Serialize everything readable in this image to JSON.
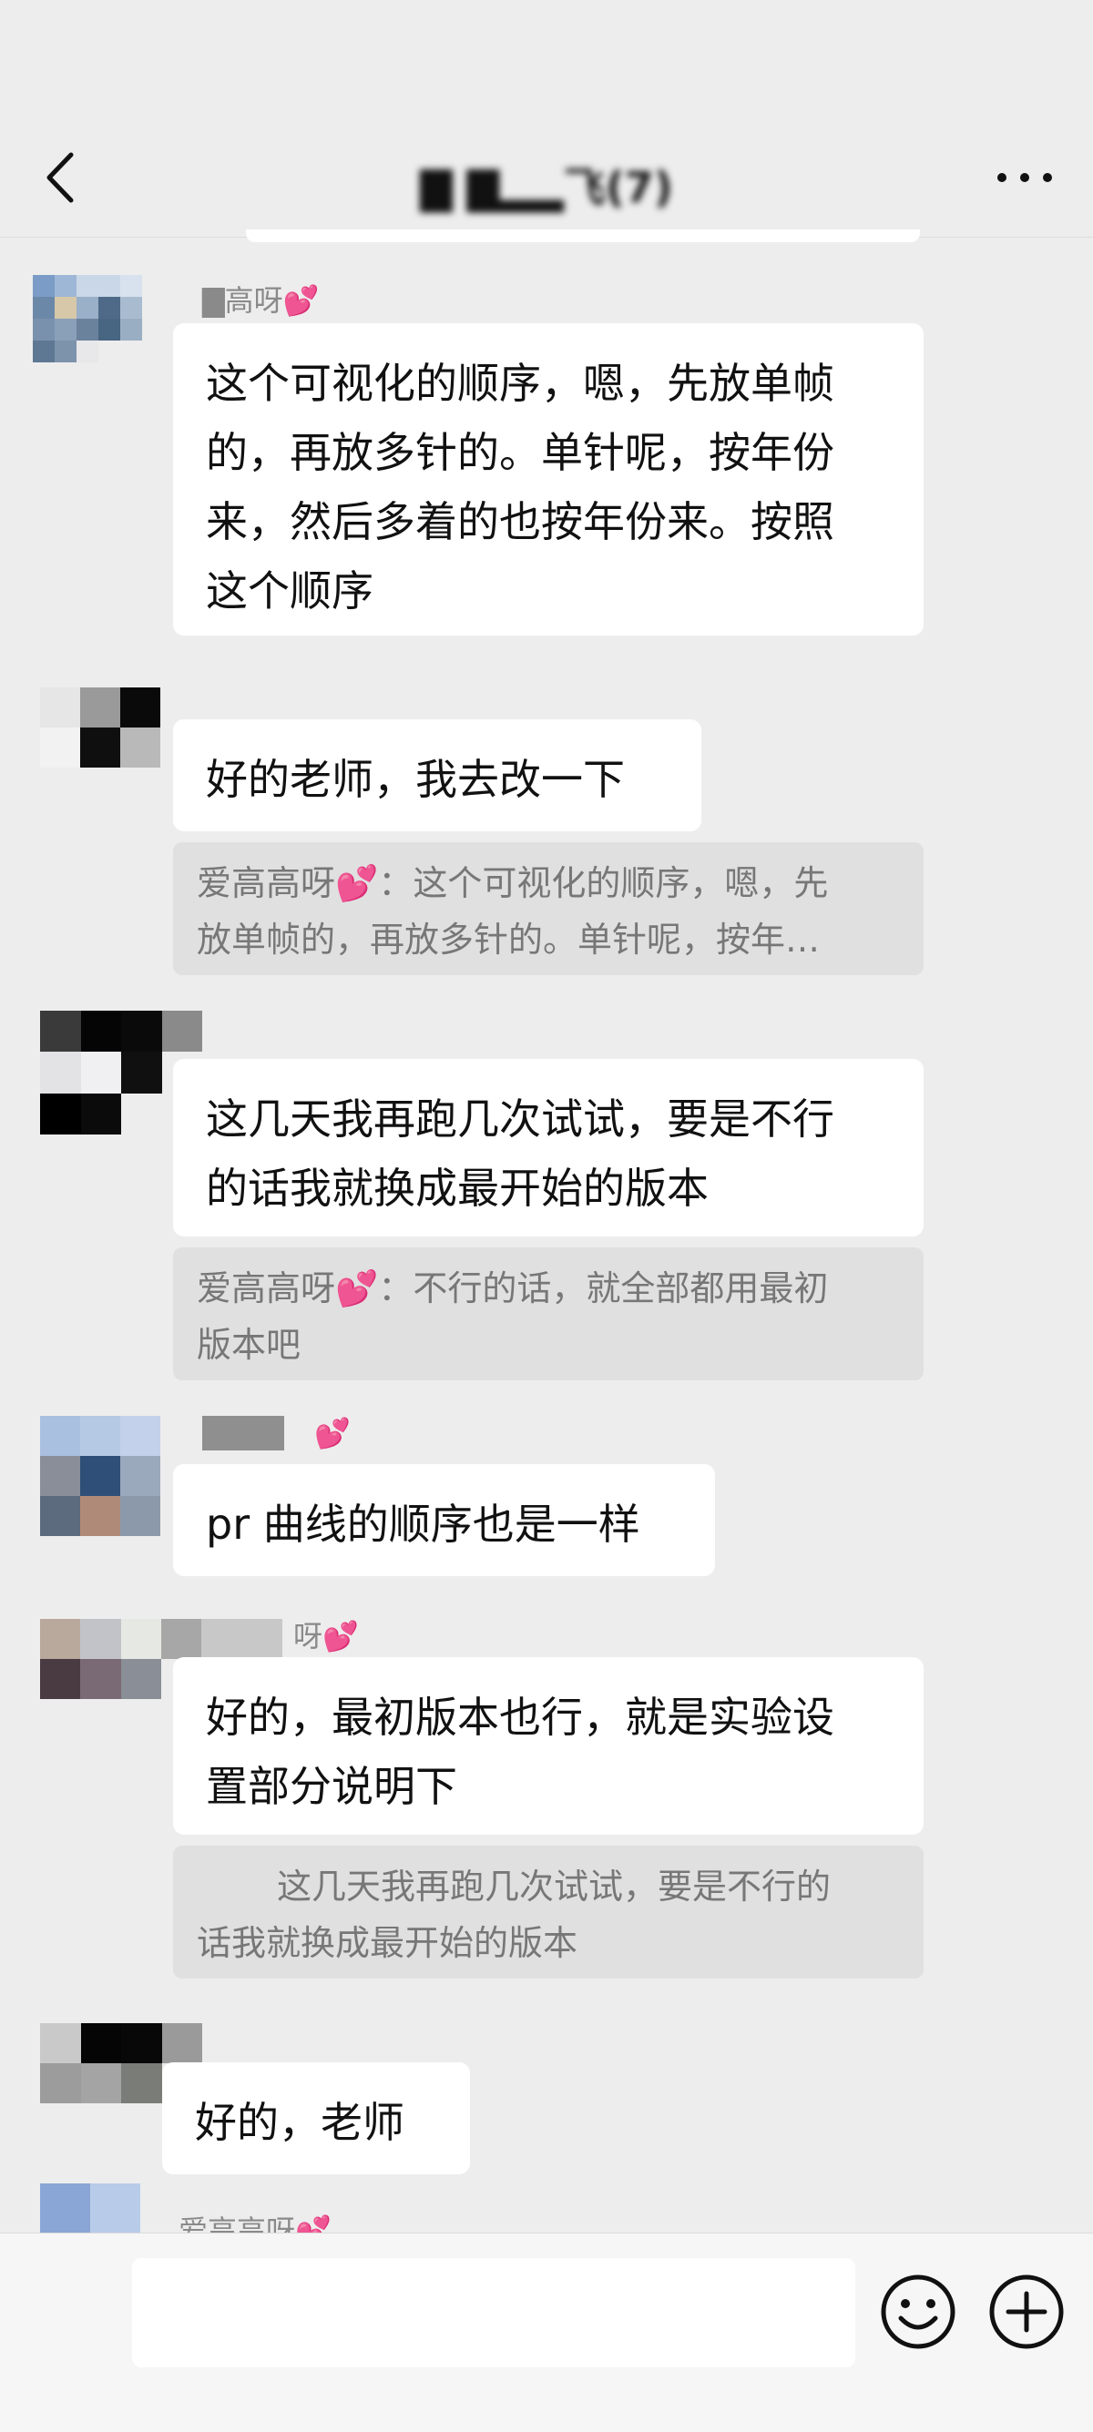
{
  "header": {
    "title": "▇ ▇▂▂飞(7)",
    "back_icon": "chevron-left-icon",
    "more_icon": "ellipsis-icon"
  },
  "messages": [
    {
      "sender": "▇高呀💕",
      "lines": [
        "这个可视化的顺序，嗯，先放单帧",
        "的，再放多针的。单针呢，按年份",
        "来，然后多着的也按年份来。按照",
        "这个顺序"
      ]
    },
    {
      "lines": [
        "好的老师，我去改一下"
      ],
      "quote": {
        "name": "爱高高呀💕：",
        "lines": [
          "这个可视化的顺序，嗯，先",
          "放单帧的，再放多针的。单针呢，按年…"
        ]
      }
    },
    {
      "lines": [
        "这几天我再跑几次试试，要是不行",
        "的话我就换成最开始的版本"
      ],
      "quote": {
        "name": "爱高高呀💕：",
        "lines": [
          "不行的话，就全部都用最初",
          "版本吧"
        ]
      }
    },
    {
      "sender": "💕",
      "lines": [
        "pr 曲线的顺序也是一样"
      ]
    },
    {
      "sender": "呀💕",
      "lines": [
        "好的，最初版本也行，就是实验设",
        "置部分说明下"
      ],
      "quote": {
        "name": "",
        "lines": [
          "这几天我再跑几次试试，要是不行的",
          "话我就换成最开始的版本"
        ]
      }
    },
    {
      "lines": [
        "好的，老师"
      ]
    },
    {
      "sender": "爱高高呀💕"
    }
  ],
  "input": {
    "placeholder": "",
    "emoji_icon": "smiley-icon",
    "plus_icon": "plus-circle-icon"
  },
  "colors": {
    "background": "#ededed",
    "bubble": "#ffffff",
    "quote": "#e0e0e0",
    "heart": "#e83d9a"
  }
}
